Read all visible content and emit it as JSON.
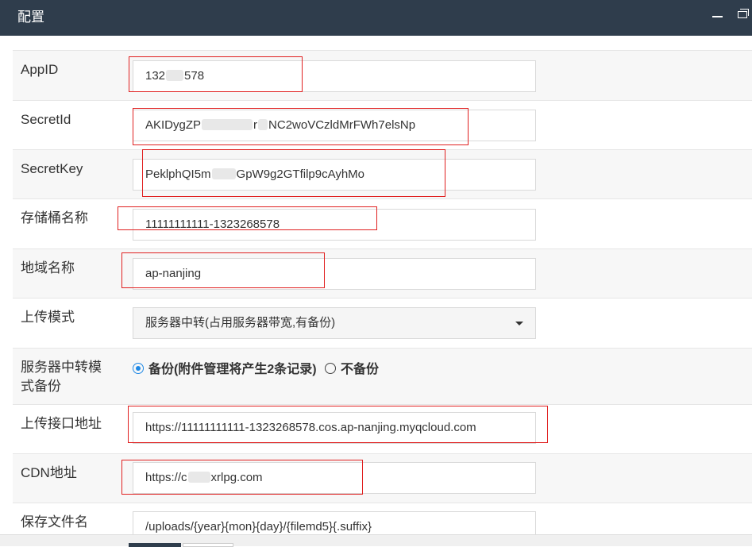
{
  "window": {
    "title": "配置"
  },
  "form": {
    "appid": {
      "label": "AppID",
      "value_start": "132",
      "value_end": "578"
    },
    "secretid": {
      "label": "SecretId",
      "value_start": "AKIDygZP",
      "value_mid": "r",
      "value_end": "NC2woVCzldMrFWh7elsNp"
    },
    "secretkey": {
      "label": "SecretKey",
      "value_start": "PeklphQI5m",
      "value_end": "GpW9g2GTfilp9cAyhMo"
    },
    "bucket": {
      "label": "存储桶名称",
      "value": "11111111111-1323268578"
    },
    "region": {
      "label": "地域名称",
      "value": "ap-nanjing"
    },
    "upload_mode": {
      "label": "上传模式",
      "selected": "服务器中转(占用服务器带宽,有备份)"
    },
    "backup": {
      "label": "服务器中转模式备份",
      "options": [
        {
          "label": "备份(附件管理将产生2条记录)",
          "checked": true
        },
        {
          "label": "不备份",
          "checked": false
        }
      ]
    },
    "upload_url": {
      "label": "上传接口地址",
      "value": "https://11111111111-1323268578.cos.ap-nanjing.myqcloud.com"
    },
    "cdn": {
      "label": "CDN地址",
      "value_start": "https://c",
      "value_end": "xrlpg.com"
    },
    "save_name": {
      "label": "保存文件名",
      "value": "/uploads/{year}{mon}{day}/{filemd5}{.suffix}"
    }
  },
  "colors": {
    "titlebar": "#2f3d4c",
    "annotation": "#e02020",
    "radio_accent": "#1e88e5"
  }
}
